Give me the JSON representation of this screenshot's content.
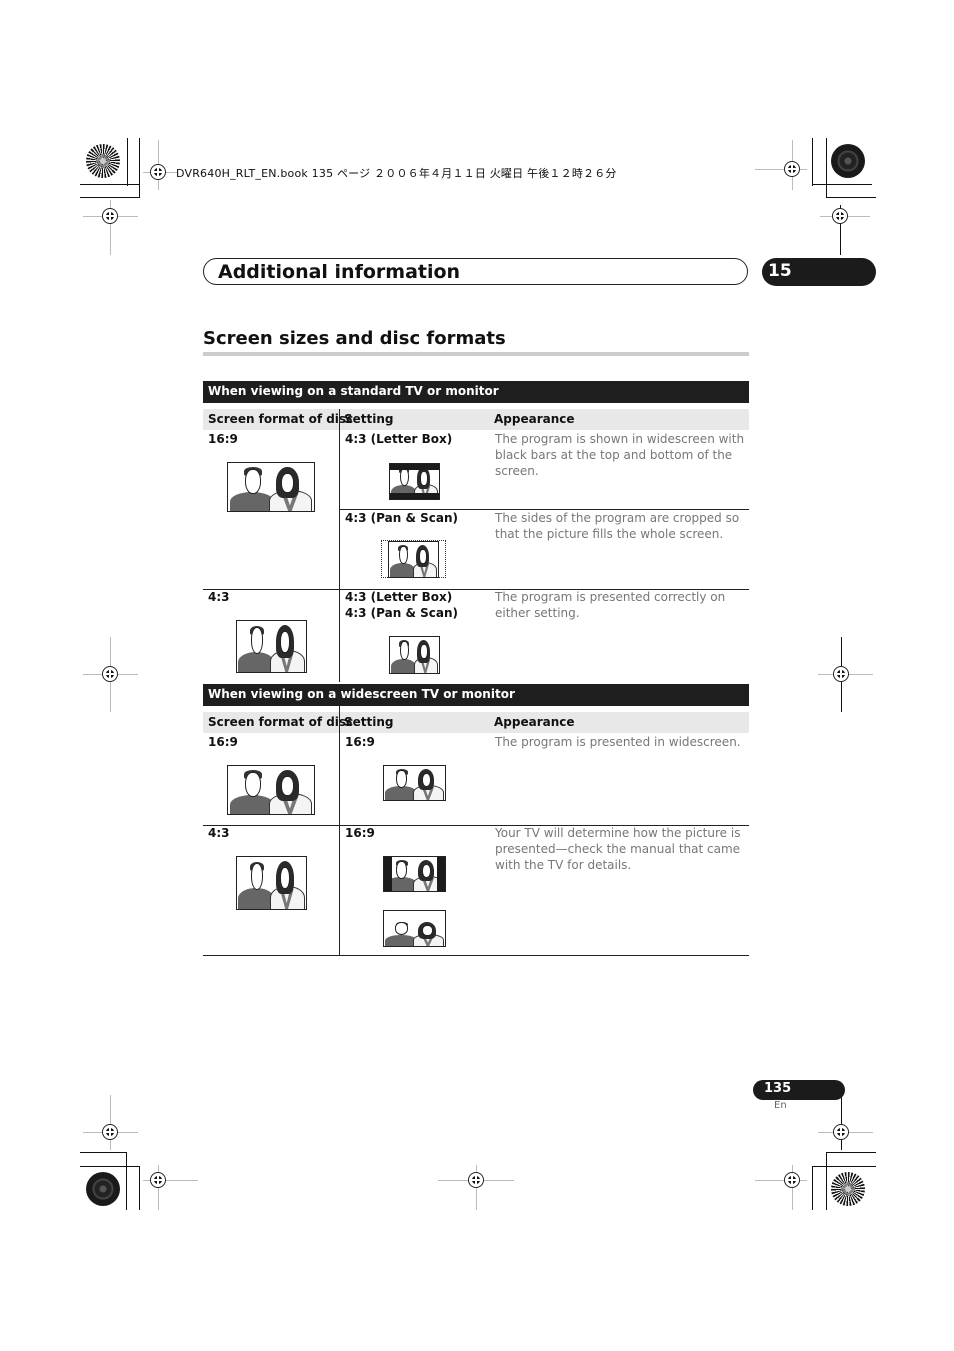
{
  "print_header": {
    "book_line": "DVR640H_RLT_EN.book  135 ページ  ２００６年４月１１日  火曜日  午後１２時２６分"
  },
  "chapter": {
    "title": "Additional information",
    "number": "15"
  },
  "section": {
    "title": "Screen sizes and disc formats"
  },
  "standard_tv": {
    "band_title": "When viewing on a standard TV or monitor",
    "columns": [
      "Screen format of disc",
      "Setting",
      "Appearance"
    ],
    "rows": [
      {
        "disc_format": "16:9",
        "disc_image": "widescreen-picture",
        "settings": [
          {
            "labels": [
              "4:3 (Letter Box)"
            ],
            "image": "letterbox-picture",
            "appearance": "The program is shown in widescreen with black bars at the top and bottom of the screen."
          },
          {
            "labels": [
              "4:3 (Pan & Scan)"
            ],
            "image": "pan-scan-picture",
            "appearance": "The sides of the program are cropped so that the picture fills the whole screen."
          }
        ]
      },
      {
        "disc_format": "4:3",
        "disc_image": "standard-picture",
        "settings": [
          {
            "labels": [
              "4:3 (Letter Box)",
              "4:3 (Pan & Scan)"
            ],
            "image": "standard-picture",
            "appearance": "The program is presented correctly on either setting."
          }
        ]
      }
    ]
  },
  "widescreen_tv": {
    "band_title": "When viewing on a widescreen TV or monitor",
    "columns": [
      "Screen format of disc",
      "Setting",
      "Appearance"
    ],
    "rows": [
      {
        "disc_format": "16:9",
        "disc_image": "widescreen-picture",
        "settings": [
          {
            "labels": [
              "16:9"
            ],
            "image": "widescreen-picture",
            "appearance": "The program is presented in widescreen."
          }
        ]
      },
      {
        "disc_format": "4:3",
        "disc_image": "standard-picture",
        "settings": [
          {
            "labels": [
              "16:9"
            ],
            "images": [
              "pillarbox-picture",
              "stretched-picture"
            ],
            "appearance": "Your TV will determine how the picture is presented—check the manual that came with the TV for details."
          }
        ]
      }
    ]
  },
  "footer": {
    "page_number": "135",
    "language": "En"
  }
}
